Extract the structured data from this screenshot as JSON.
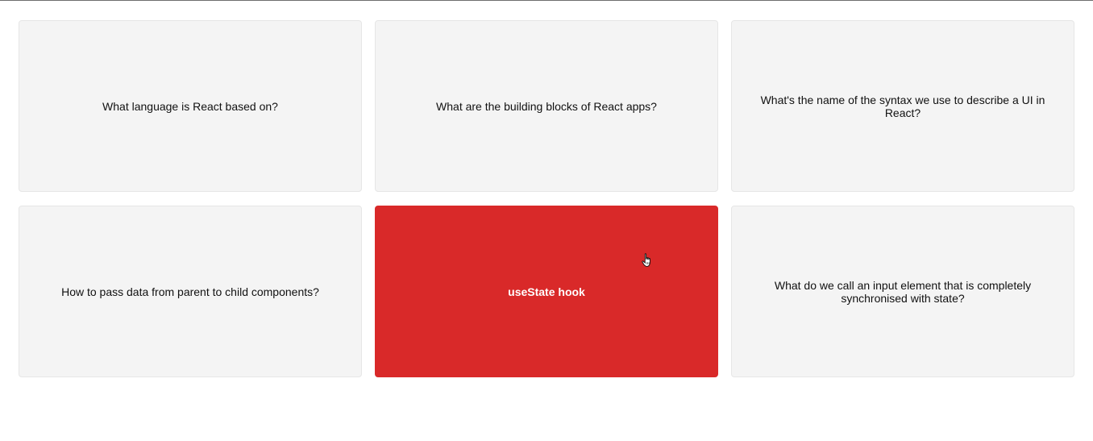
{
  "cards": [
    {
      "text": "What language is React based on?",
      "state": "front"
    },
    {
      "text": "What are the building blocks of React apps?",
      "state": "front"
    },
    {
      "text": "What's the name of the syntax we use to describe a UI in React?",
      "state": "front"
    },
    {
      "text": "How to pass data from parent to child components?",
      "state": "front"
    },
    {
      "text": "useState hook",
      "state": "flipped"
    },
    {
      "text": "What do we call an input element that is completely synchronised with state?",
      "state": "front"
    }
  ],
  "colors": {
    "card_background": "#f4f4f4",
    "card_border": "#e6e6e6",
    "selected_background": "#d92929",
    "selected_text": "#ffffff"
  },
  "icons": {
    "cursor": "hand-pointer-icon"
  }
}
